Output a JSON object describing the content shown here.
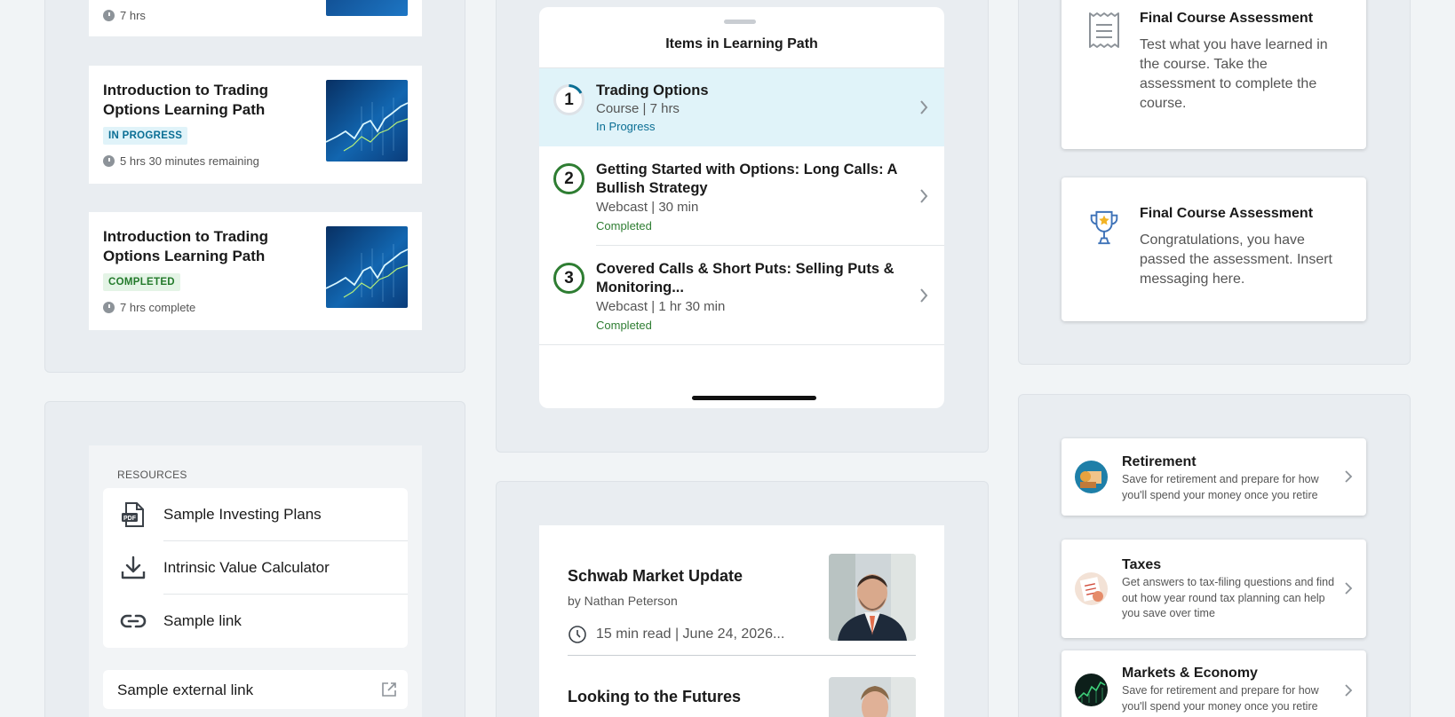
{
  "col1": {
    "top_card": {
      "meta": "7 hrs"
    },
    "course_cards": [
      {
        "title": "Introduction to Trading Options Learning Path",
        "badge": "IN PROGRESS",
        "meta": "5 hrs 30 minutes remaining"
      },
      {
        "title": "Introduction to Trading Options Learning Path",
        "badge": "COMPLETED",
        "meta": "7 hrs complete"
      }
    ],
    "resources": {
      "label": "RESOURCES",
      "items": [
        {
          "label": "Sample Investing Plans",
          "icon": "pdf-icon"
        },
        {
          "label": "Intrinsic Value Calculator",
          "icon": "download-icon"
        },
        {
          "label": "Sample link",
          "icon": "link-icon"
        }
      ],
      "external": {
        "label": "Sample external link",
        "icon": "external-link-icon"
      }
    }
  },
  "learning_path": {
    "title": "Items in Learning Path",
    "items": [
      {
        "num": "1",
        "title": "Trading Options",
        "sub": "Course | 7 hrs",
        "status": "In Progress"
      },
      {
        "num": "2",
        "title": "Getting Started with Options: Long Calls: A Bullish Strategy",
        "sub": "Webcast | 30 min",
        "status": "Completed"
      },
      {
        "num": "3",
        "title": "Covered Calls & Short Puts: Selling Puts & Monitoring...",
        "sub": "Webcast | 1 hr 30 min",
        "status": "Completed"
      }
    ]
  },
  "articles": [
    {
      "title": "Schwab Market Update",
      "byline": "by Nathan Peterson",
      "meta": "15 min read | June 24, 2026..."
    },
    {
      "title": "Looking to the Futures"
    }
  ],
  "assessments": [
    {
      "title": "Final Course Assessment",
      "body": "Test what you have learned in the course. Take the assessment to complete the course.",
      "icon": "document-icon"
    },
    {
      "title": "Final Course Assessment",
      "body": "Congratulations, you have passed the assessment. Insert messaging here.",
      "icon": "trophy-icon"
    }
  ],
  "topics": [
    {
      "title": "Retirement",
      "body": "Save for retirement and prepare for how you'll spend your money once you retire"
    },
    {
      "title": "Taxes",
      "body": "Get answers to tax-filing questions and find out how year round tax planning can help you save over time"
    },
    {
      "title": "Markets & Economy",
      "body": "Save for retirement and prepare for how you'll spend your money once you retire"
    }
  ],
  "colors": {
    "accent": "#0a6e94",
    "progress_bg": "#e0f3f9",
    "success": "#2e7d32",
    "highlight_row": "#e0f3f9"
  }
}
